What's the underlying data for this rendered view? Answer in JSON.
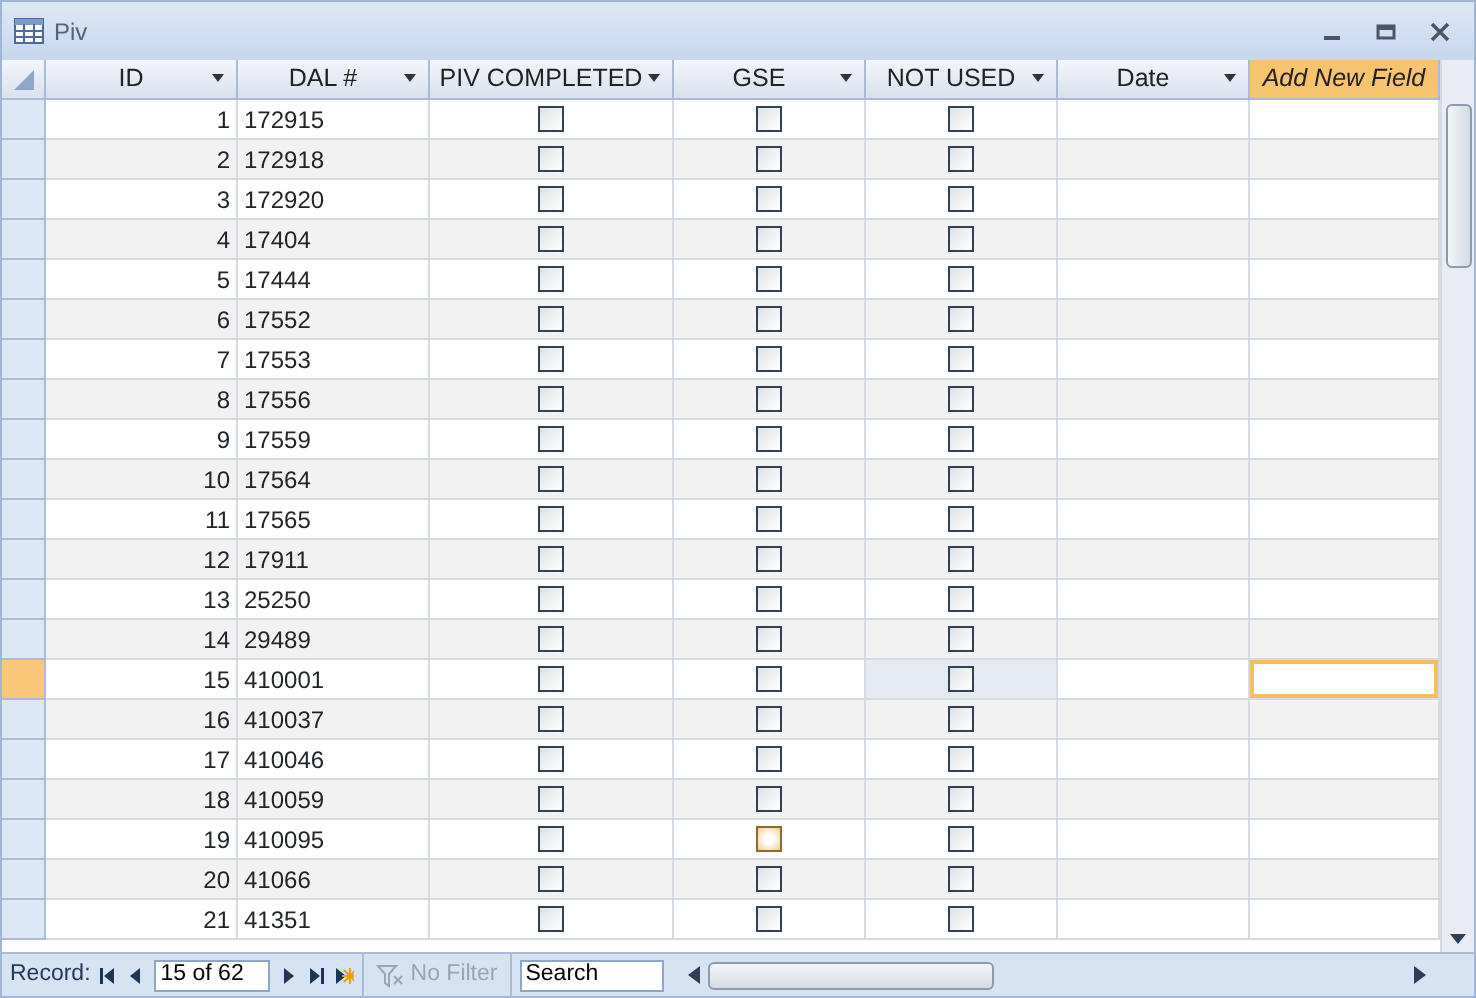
{
  "window": {
    "title": "Piv"
  },
  "columns": [
    {
      "label": "ID",
      "dropdown": true,
      "kind": "number"
    },
    {
      "label": "DAL #",
      "dropdown": true,
      "kind": "text"
    },
    {
      "label": "PIV COMPLETED",
      "dropdown": true,
      "kind": "check"
    },
    {
      "label": "GSE",
      "dropdown": true,
      "kind": "check"
    },
    {
      "label": "NOT USED",
      "dropdown": true,
      "kind": "check"
    },
    {
      "label": "Date",
      "dropdown": true,
      "kind": "text"
    },
    {
      "label": "Add New Field",
      "dropdown": false,
      "kind": "new"
    }
  ],
  "rows": [
    {
      "id": "1",
      "dal": "172915",
      "piv": false,
      "gse": false,
      "not_used": false,
      "selected": false
    },
    {
      "id": "2",
      "dal": "172918",
      "piv": false,
      "gse": false,
      "not_used": false,
      "selected": false
    },
    {
      "id": "3",
      "dal": "172920",
      "piv": false,
      "gse": false,
      "not_used": false,
      "selected": false
    },
    {
      "id": "4",
      "dal": "17404",
      "piv": false,
      "gse": false,
      "not_used": false,
      "selected": false
    },
    {
      "id": "5",
      "dal": "17444",
      "piv": false,
      "gse": false,
      "not_used": false,
      "selected": false
    },
    {
      "id": "6",
      "dal": "17552",
      "piv": false,
      "gse": false,
      "not_used": false,
      "selected": false
    },
    {
      "id": "7",
      "dal": "17553",
      "piv": false,
      "gse": false,
      "not_used": false,
      "selected": false
    },
    {
      "id": "8",
      "dal": "17556",
      "piv": false,
      "gse": false,
      "not_used": false,
      "selected": false
    },
    {
      "id": "9",
      "dal": "17559",
      "piv": false,
      "gse": false,
      "not_used": false,
      "selected": false
    },
    {
      "id": "10",
      "dal": "17564",
      "piv": false,
      "gse": false,
      "not_used": false,
      "selected": false
    },
    {
      "id": "11",
      "dal": "17565",
      "piv": false,
      "gse": false,
      "not_used": false,
      "selected": false
    },
    {
      "id": "12",
      "dal": "17911",
      "piv": false,
      "gse": false,
      "not_used": false,
      "selected": false
    },
    {
      "id": "13",
      "dal": "25250",
      "piv": false,
      "gse": false,
      "not_used": false,
      "selected": false
    },
    {
      "id": "14",
      "dal": "29489",
      "piv": false,
      "gse": false,
      "not_used": false,
      "selected": false
    },
    {
      "id": "15",
      "dal": "410001",
      "piv": false,
      "gse": false,
      "not_used": false,
      "selected": true
    },
    {
      "id": "16",
      "dal": "410037",
      "piv": false,
      "gse": false,
      "not_used": false,
      "selected": false
    },
    {
      "id": "17",
      "dal": "410046",
      "piv": false,
      "gse": false,
      "not_used": false,
      "selected": false
    },
    {
      "id": "18",
      "dal": "410059",
      "piv": false,
      "gse": false,
      "not_used": false,
      "selected": false
    },
    {
      "id": "19",
      "dal": "410095",
      "piv": false,
      "gse": false,
      "not_used": false,
      "selected": false,
      "gse_hover": true
    },
    {
      "id": "20",
      "dal": "41066",
      "piv": false,
      "gse": false,
      "not_used": false,
      "selected": false
    },
    {
      "id": "21",
      "dal": "41351",
      "piv": false,
      "gse": false,
      "not_used": false,
      "selected": false
    }
  ],
  "navigation": {
    "label": "Record:",
    "position": "15 of 62",
    "filter": {
      "label": "No Filter",
      "disabled": true
    },
    "search": {
      "placeholder": "Search"
    }
  }
}
